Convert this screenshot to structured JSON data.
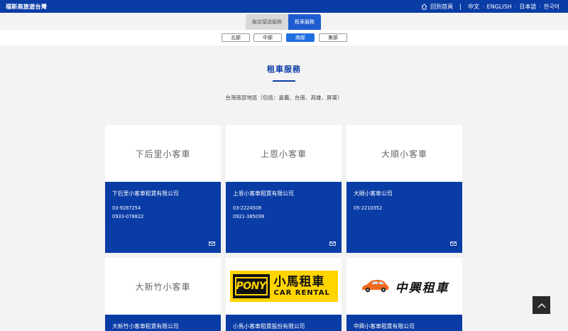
{
  "header": {
    "brand": "福斯商旅遊台灣",
    "home_label": "回到首頁",
    "languages": [
      "中文",
      "ENGLISH",
      "日本語",
      "한국어"
    ]
  },
  "tabs": [
    "飯店接送服務",
    "租車服務"
  ],
  "regions": [
    "北部",
    "中部",
    "南部",
    "東部"
  ],
  "section": {
    "title": "租車服務",
    "description": "台灣南部地區（包括：嘉義、台南、高雄、屏東）"
  },
  "cards": [
    {
      "photo_text": "下后里小客車",
      "company": "下后里小客車租賃有限公司",
      "phones": [
        "03-9287254",
        "0933-078822"
      ]
    },
    {
      "photo_text": "上恩小客車",
      "company": "上恩小客車租賃有限公司",
      "phones": [
        "03-2224508",
        "0921-385099"
      ]
    },
    {
      "photo_text": "大順小客車",
      "company": "大順小客車公司",
      "phones": [
        "05-2210352"
      ]
    },
    {
      "photo_text": "大新竹小客車",
      "company": "大新竹小客車租賃有限公司",
      "phones": []
    },
    {
      "logo_cn": "小馬租車",
      "logo_en": "CAR RENTAL",
      "logo_word": "PONY",
      "company": "小馬小客車租賃股份有限公司",
      "phones": []
    },
    {
      "logo_cn": "中興租車",
      "company": "中興小客車租賃有限公司",
      "phones": []
    }
  ],
  "colors": {
    "primary": "#0a3ca6",
    "accent": "#1e6fe0",
    "pony_yellow": "#ffd400",
    "car_orange": "#f26b1d"
  }
}
